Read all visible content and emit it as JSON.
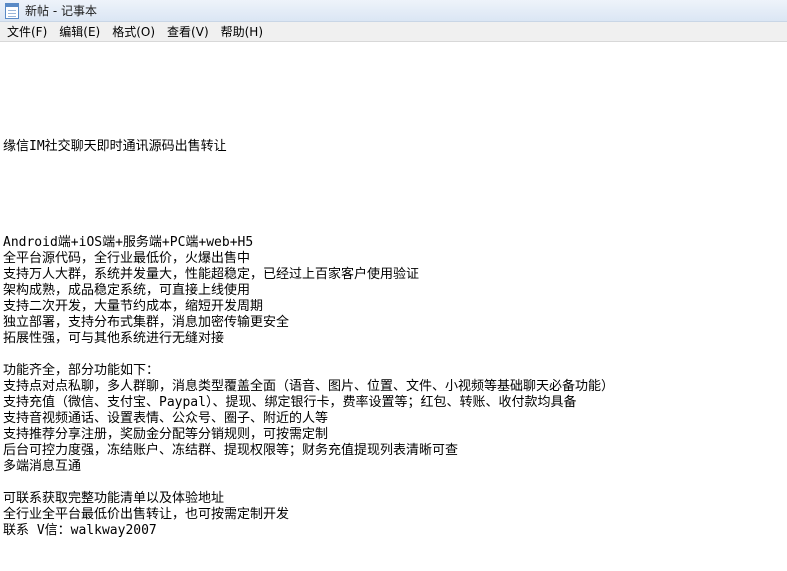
{
  "window": {
    "title": "新帖 - 记事本"
  },
  "menu": {
    "items": [
      "文件(F)",
      "编辑(E)",
      "格式(O)",
      "查看(V)",
      "帮助(H)"
    ]
  },
  "editor": {
    "lines": [
      "",
      "",
      "",
      "缘信IM社交聊天即时通讯源码出售转让",
      "",
      "",
      "",
      "",
      "",
      "Android端+iOS端+服务端+PC端+web+H5",
      "全平台源代码，全行业最低价，火爆出售中",
      "支持万人大群，系统并发量大，性能超稳定，已经过上百家客户使用验证",
      "架构成熟，成品稳定系统，可直接上线使用",
      "支持二次开发，大量节约成本，缩短开发周期",
      "独立部署，支持分布式集群，消息加密传输更安全",
      "拓展性强，可与其他系统进行无缝对接",
      "",
      "功能齐全，部分功能如下：",
      "支持点对点私聊，多人群聊，消息类型覆盖全面（语音、图片、位置、文件、小视频等基础聊天必备功能）",
      "支持充值（微信、支付宝、Paypal）、提现、绑定银行卡，费率设置等；红包、转账、收付款均具备",
      "支持音视频通话、设置表情、公众号、圈子、附近的人等",
      "支持推荐分享注册，奖励金分配等分销规则，可按需定制",
      "后台可控力度强，冻结账户、冻结群、提现权限等；财务充值提现列表清晰可查",
      "多端消息互通",
      "",
      "可联系获取完整功能清单以及体验地址",
      "全行业全平台最低价出售转让，也可按需定制开发",
      "联系 V信：walkway2007"
    ]
  }
}
